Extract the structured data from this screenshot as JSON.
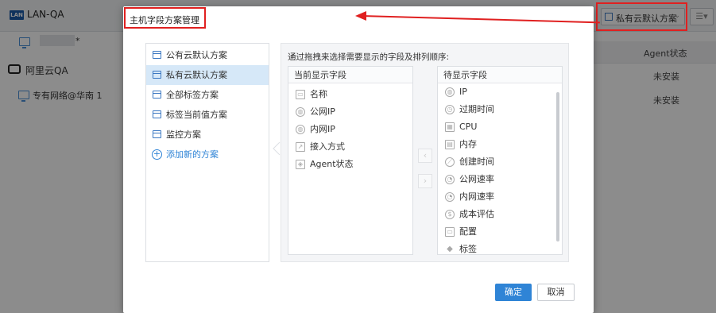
{
  "app": {
    "badge": "LAN",
    "title": "LAN-QA",
    "tree": {
      "item1_suffix": "*",
      "cloud_label": "阿里云QA",
      "network_label": "专有网络@华南 1"
    },
    "table": {
      "agent_header": "Agent状态",
      "rows": [
        "未安装",
        "未安装"
      ]
    },
    "top_select": "私有云默认方案",
    "colors": {
      "accent": "#2f84d6",
      "annotation": "#e02020"
    }
  },
  "dialog": {
    "title": "主机字段方案管理",
    "schemes": [
      {
        "label": "公有云默认方案",
        "active": false
      },
      {
        "label": "私有云默认方案",
        "active": true
      },
      {
        "label": "全部标签方案",
        "active": false
      },
      {
        "label": "标签当前值方案",
        "active": false
      },
      {
        "label": "监控方案",
        "active": false
      }
    ],
    "add_scheme": "添加新的方案",
    "instruction": "通过拖拽来选择需要显示的字段及排列顺序:",
    "current": {
      "header": "当前显示字段",
      "fields": [
        {
          "label": "名称",
          "icon": "monitor-icon"
        },
        {
          "label": "公网IP",
          "icon": "globe-icon"
        },
        {
          "label": "内网IP",
          "icon": "globe-icon"
        },
        {
          "label": "接入方式",
          "icon": "share-icon"
        },
        {
          "label": "Agent状态",
          "icon": "agent-icon"
        }
      ]
    },
    "pending": {
      "header": "待显示字段",
      "fields": [
        {
          "label": "IP",
          "icon": "globe-icon"
        },
        {
          "label": "过期时间",
          "icon": "clock-icon"
        },
        {
          "label": "CPU",
          "icon": "cpu-icon"
        },
        {
          "label": "内存",
          "icon": "memory-icon"
        },
        {
          "label": "创建时间",
          "icon": "compass-icon"
        },
        {
          "label": "公网速率",
          "icon": "speed-icon"
        },
        {
          "label": "内网速率",
          "icon": "speed-icon"
        },
        {
          "label": "成本评估",
          "icon": "dollar-icon"
        },
        {
          "label": "配置",
          "icon": "config-icon"
        },
        {
          "label": "标签",
          "icon": "tag-icon"
        }
      ]
    },
    "ok_label": "确定",
    "cancel_label": "取消"
  }
}
